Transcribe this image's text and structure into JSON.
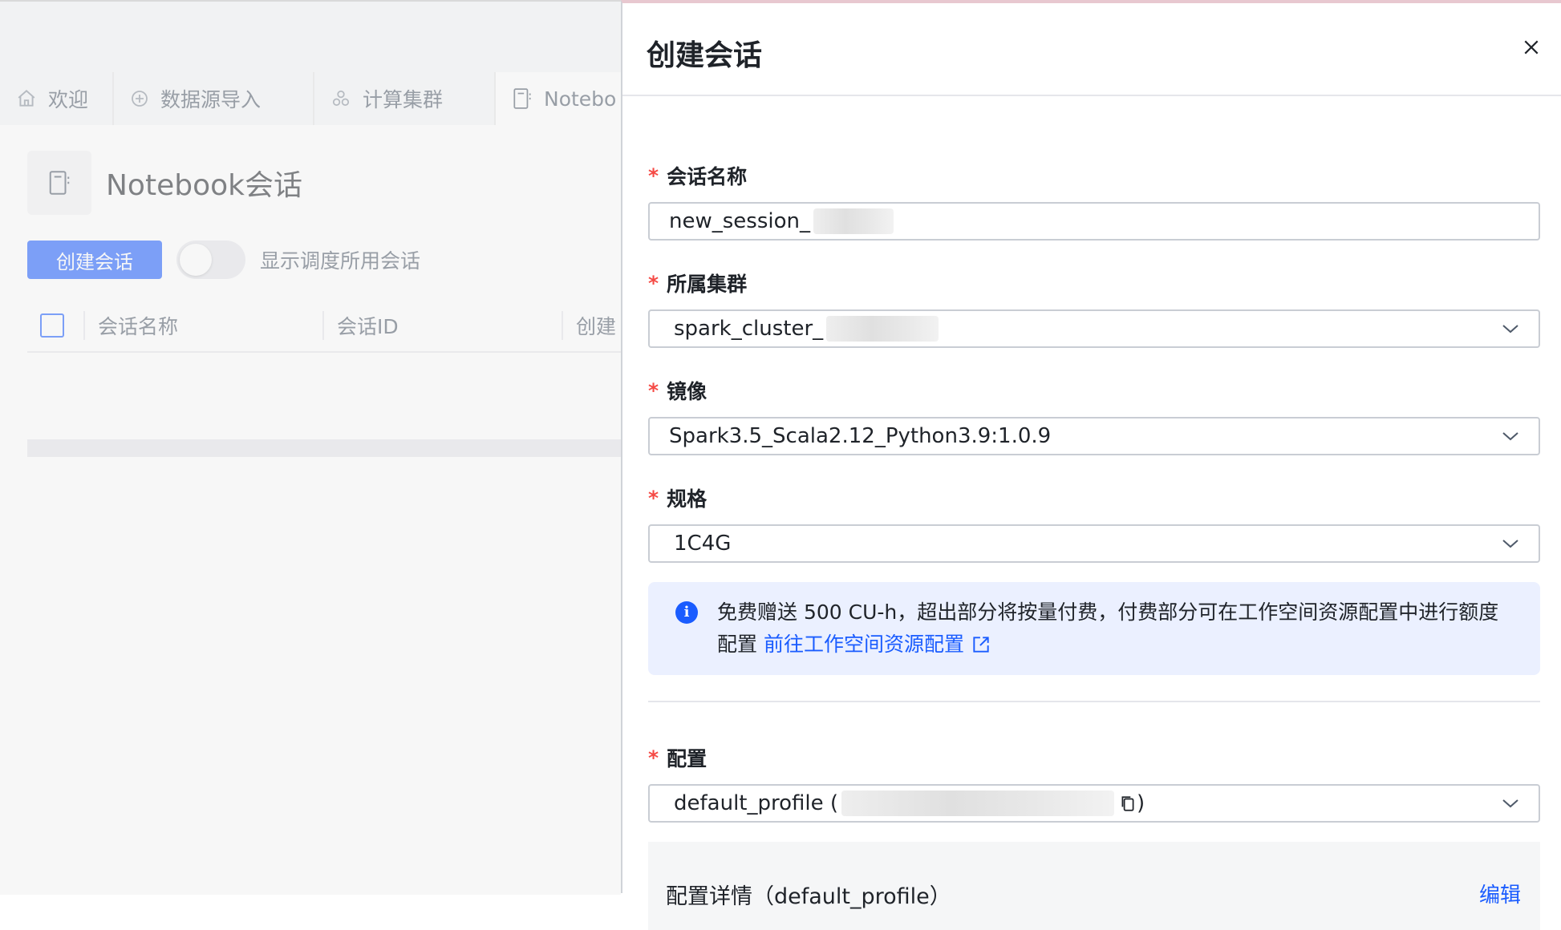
{
  "background": {
    "tabs": [
      {
        "label": "欢迎",
        "icon": "home-icon"
      },
      {
        "label": "数据源导入",
        "icon": "plus-circle-icon"
      },
      {
        "label": "计算集群",
        "icon": "cluster-icon"
      },
      {
        "label": "Notebo",
        "icon": "notebook-icon"
      }
    ],
    "page_title": "Notebook会话",
    "create_button": "创建会话",
    "toggle_label": "显示调度所用会话",
    "table_columns": [
      "会话名称",
      "会话ID",
      "创建"
    ]
  },
  "drawer": {
    "title": "创建会话",
    "fields": {
      "session_name": {
        "label": "会话名称",
        "value": "new_session_"
      },
      "cluster": {
        "label": "所属集群",
        "value": "spark_cluster_"
      },
      "image": {
        "label": "镜像",
        "value": "Spark3.5_Scala2.12_Python3.9:1.0.9"
      },
      "spec": {
        "label": "规格",
        "value": "1C4G"
      },
      "config": {
        "label": "配置",
        "value_prefix": "default_profile (",
        "value_suffix": ")"
      }
    },
    "alert": {
      "text": "免费赠送 500 CU-h，超出部分将按量付费，付费部分可在工作空间资源配置中进行额度配置",
      "link": "前往工作空间资源配置"
    },
    "details": {
      "title": "配置详情（default_profile）",
      "edit": "编辑"
    }
  },
  "colors": {
    "primary": "#1a5cff",
    "required": "#f54a45",
    "alert_bg": "#ebf0ff"
  }
}
